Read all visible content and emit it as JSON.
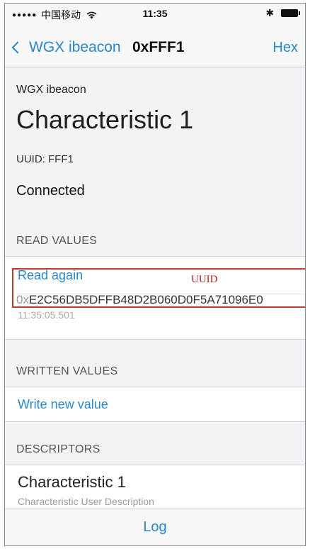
{
  "status_bar": {
    "signal_dots": "●●●●●",
    "carrier": "中国移动",
    "wifi_icon": "wifi-icon",
    "time": "11:35",
    "bluetooth": "✱"
  },
  "nav": {
    "back_label": "WGX ibeacon",
    "title": "0xFFF1",
    "right_label": "Hex"
  },
  "header": {
    "device_name": "WGX ibeacon",
    "characteristic_title": "Characteristic 1",
    "uuid_line": "UUID: FFF1",
    "connection_status": "Connected"
  },
  "read_values": {
    "section_label": "READ VALUES",
    "action_label": "Read again",
    "value_prefix": "0x",
    "value": "E2C56DB5DFFB48D2B060D0F5A71096E0",
    "timestamp": "11:35:05.501"
  },
  "annotation": {
    "label": "UUID",
    "color": "#c0392b"
  },
  "written_values": {
    "section_label": "WRITTEN VALUES",
    "action_label": "Write new value"
  },
  "descriptors": {
    "section_label": "DESCRIPTORS",
    "items": [
      {
        "title": "Characteristic 1",
        "subtitle": "Characteristic User Description"
      }
    ]
  },
  "tab_bar": {
    "log_label": "Log"
  },
  "colors": {
    "accent": "#2a87c9",
    "annotation": "#c0392b"
  }
}
